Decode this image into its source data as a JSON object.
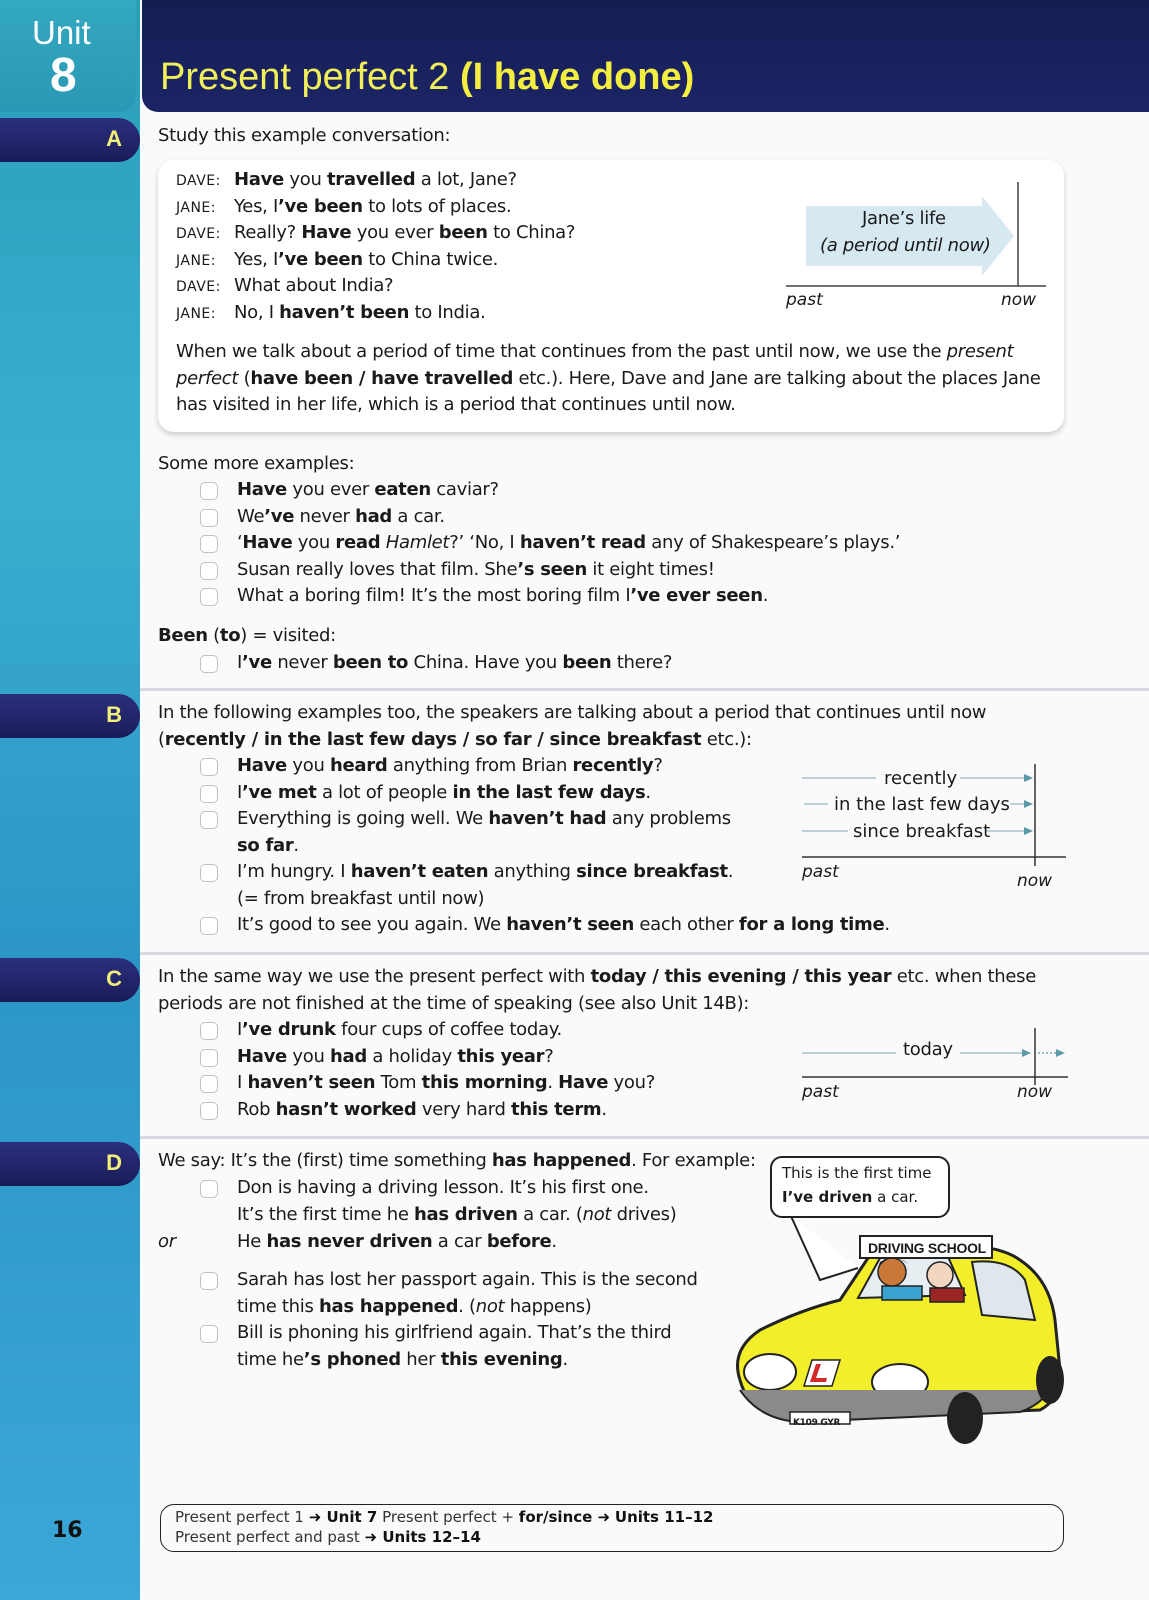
{
  "header": {
    "unit_label": "Unit",
    "unit_number": "8",
    "title_plain": "Present perfect 2 ",
    "title_bold": "(I have done)"
  },
  "page_number": "16",
  "sections": {
    "A": {
      "letter": "A",
      "intro": "Study this example conversation:",
      "dialogue": [
        {
          "speaker": "DAVE:",
          "parts": [
            {
              "b": true,
              "t": "Have"
            },
            {
              "t": " you "
            },
            {
              "b": true,
              "t": "travelled"
            },
            {
              "t": " a lot, Jane?"
            }
          ]
        },
        {
          "speaker": "JANE:",
          "parts": [
            {
              "t": "Yes, I"
            },
            {
              "b": true,
              "t": "’ve been"
            },
            {
              "t": " to lots of places."
            }
          ]
        },
        {
          "speaker": "DAVE:",
          "parts": [
            {
              "t": "Really?  "
            },
            {
              "b": true,
              "t": "Have"
            },
            {
              "t": " you ever "
            },
            {
              "b": true,
              "t": "been"
            },
            {
              "t": " to China?"
            }
          ]
        },
        {
          "speaker": "JANE:",
          "parts": [
            {
              "t": "Yes, I"
            },
            {
              "b": true,
              "t": "’ve been"
            },
            {
              "t": " to China twice."
            }
          ]
        },
        {
          "speaker": "DAVE:",
          "parts": [
            {
              "t": "What about India?"
            }
          ]
        },
        {
          "speaker": "JANE:",
          "parts": [
            {
              "t": "No, I "
            },
            {
              "b": true,
              "t": "haven’t been"
            },
            {
              "t": " to India."
            }
          ]
        }
      ],
      "diagram": {
        "label_line1": "Jane’s life",
        "label_line2": "(a period until now)",
        "past": "past",
        "now": "now"
      },
      "explanation": [
        [
          {
            "t": "When we talk about a period of time that continues from the past until now, we use the "
          },
          {
            "i": true,
            "t": "present"
          }
        ],
        [
          {
            "i": true,
            "t": "perfect"
          },
          {
            "t": " ("
          },
          {
            "b": true,
            "t": "have been / have travelled"
          },
          {
            "t": " etc.).  Here, Dave and Jane are talking about the places Jane"
          }
        ],
        [
          {
            "t": "has visited in her life, which is a period that continues until now."
          }
        ]
      ],
      "more_heading": "Some more examples:",
      "examples": [
        [
          {
            "b": true,
            "t": "Have"
          },
          {
            "t": " you ever "
          },
          {
            "b": true,
            "t": "eaten"
          },
          {
            "t": " caviar?"
          }
        ],
        [
          {
            "t": "We"
          },
          {
            "b": true,
            "t": "’ve"
          },
          {
            "t": " never "
          },
          {
            "b": true,
            "t": "had"
          },
          {
            "t": " a car."
          }
        ],
        [
          {
            "t": "‘"
          },
          {
            "b": true,
            "t": "Have"
          },
          {
            "t": " you "
          },
          {
            "b": true,
            "t": "read"
          },
          {
            "t": " "
          },
          {
            "i": true,
            "t": "Hamlet"
          },
          {
            "t": "?’   ‘No, I "
          },
          {
            "b": true,
            "t": "haven’t read"
          },
          {
            "t": " any of Shakespeare’s plays.’"
          }
        ],
        [
          {
            "t": "Susan really loves that film.  She"
          },
          {
            "b": true,
            "t": "’s seen"
          },
          {
            "t": " it eight times!"
          }
        ],
        [
          {
            "t": "What a boring film!  It’s the most boring film I"
          },
          {
            "b": true,
            "t": "’ve ever seen"
          },
          {
            "t": "."
          }
        ]
      ],
      "been_heading": [
        {
          "b": true,
          "t": "Been"
        },
        {
          "t": " ("
        },
        {
          "b": true,
          "t": "to"
        },
        {
          "t": ") = visited:"
        }
      ],
      "been_example": [
        {
          "t": "I"
        },
        {
          "b": true,
          "t": "’ve"
        },
        {
          "t": " never "
        },
        {
          "b": true,
          "t": "been to"
        },
        {
          "t": " China.  Have you "
        },
        {
          "b": true,
          "t": "been"
        },
        {
          "t": " there?"
        }
      ]
    },
    "B": {
      "letter": "B",
      "intro": [
        [
          {
            "t": "In the following examples too, the speakers are talking about a period that continues until now"
          }
        ],
        [
          {
            "t": "("
          },
          {
            "b": true,
            "t": "recently / in the last few days / so far / since breakfast"
          },
          {
            "t": " etc.):"
          }
        ]
      ],
      "examples": [
        [
          [
            {
              "b": true,
              "t": "Have"
            },
            {
              "t": " you "
            },
            {
              "b": true,
              "t": "heard"
            },
            {
              "t": " anything from Brian "
            },
            {
              "b": true,
              "t": "recently"
            },
            {
              "t": "?"
            }
          ]
        ],
        [
          [
            {
              "t": "I"
            },
            {
              "b": true,
              "t": "’ve met"
            },
            {
              "t": " a lot of people "
            },
            {
              "b": true,
              "t": "in the last few days"
            },
            {
              "t": "."
            }
          ]
        ],
        [
          [
            {
              "t": "Everything is going well.  We "
            },
            {
              "b": true,
              "t": "haven’t had"
            },
            {
              "t": " any problems"
            }
          ],
          [
            {
              "b": true,
              "t": "so far"
            },
            {
              "t": "."
            }
          ]
        ],
        [
          [
            {
              "t": "I’m hungry.  I "
            },
            {
              "b": true,
              "t": "haven’t eaten"
            },
            {
              "t": " anything "
            },
            {
              "b": true,
              "t": "since breakfast"
            },
            {
              "t": "."
            }
          ],
          [
            {
              "t": "(= from breakfast until now)"
            }
          ]
        ],
        [
          [
            {
              "t": "It’s good to see you again.  We "
            },
            {
              "b": true,
              "t": "haven’t seen"
            },
            {
              "t": " each other "
            },
            {
              "b": true,
              "t": "for a long time"
            },
            {
              "t": "."
            }
          ]
        ]
      ],
      "diagram": {
        "lines": [
          "recently",
          "in the last few days",
          "since breakfast"
        ],
        "past": "past",
        "now": "now"
      }
    },
    "C": {
      "letter": "C",
      "intro": [
        [
          {
            "t": "In the same way we use the present perfect with "
          },
          {
            "b": true,
            "t": "today / this evening / this year"
          },
          {
            "t": " etc. when these"
          }
        ],
        [
          {
            "t": "periods are not finished at the time of speaking (see also Unit 14B):"
          }
        ]
      ],
      "examples": [
        [
          {
            "t": "I"
          },
          {
            "b": true,
            "t": "’ve drunk"
          },
          {
            "t": " four cups of coffee today."
          }
        ],
        [
          {
            "b": true,
            "t": "Have"
          },
          {
            "t": " you "
          },
          {
            "b": true,
            "t": "had"
          },
          {
            "t": " a holiday "
          },
          {
            "b": true,
            "t": "this year"
          },
          {
            "t": "?"
          }
        ],
        [
          {
            "t": "I "
          },
          {
            "b": true,
            "t": "haven’t seen"
          },
          {
            "t": " Tom "
          },
          {
            "b": true,
            "t": "this morning"
          },
          {
            "t": ".  "
          },
          {
            "b": true,
            "t": "Have"
          },
          {
            "t": " you?"
          }
        ],
        [
          {
            "t": "Rob "
          },
          {
            "b": true,
            "t": "hasn’t worked"
          },
          {
            "t": " very hard "
          },
          {
            "b": true,
            "t": "this term"
          },
          {
            "t": "."
          }
        ]
      ],
      "diagram": {
        "label": "today",
        "past": "past",
        "now": "now"
      }
    },
    "D": {
      "letter": "D",
      "intro": [
        {
          "t": "We say: It’s the (first) time something "
        },
        {
          "b": true,
          "t": "has happened"
        },
        {
          "t": ".  For example:"
        }
      ],
      "ex1_line1": [
        {
          "t": "Don is having a driving lesson.  It’s his first one."
        }
      ],
      "ex1_line2": [
        {
          "t": "It’s the first time he "
        },
        {
          "b": true,
          "t": "has driven"
        },
        {
          "t": " a car.   ("
        },
        {
          "i": true,
          "t": "not"
        },
        {
          "t": " drives)"
        }
      ],
      "or_label": "or",
      "ex1_line3": [
        {
          "t": "He "
        },
        {
          "b": true,
          "t": "has never driven"
        },
        {
          "t": " a car "
        },
        {
          "b": true,
          "t": "before"
        },
        {
          "t": "."
        }
      ],
      "ex2": [
        [
          {
            "t": "Sarah has lost her passport again.  This is the second"
          }
        ],
        [
          {
            "t": "time this "
          },
          {
            "b": true,
            "t": "has happened"
          },
          {
            "t": ".   ("
          },
          {
            "i": true,
            "t": "not"
          },
          {
            "t": " happens)"
          }
        ]
      ],
      "ex3": [
        [
          {
            "t": "Bill is phoning his girlfriend again.  That’s the third"
          }
        ],
        [
          {
            "t": "time he"
          },
          {
            "b": true,
            "t": "’s phoned"
          },
          {
            "t": " her "
          },
          {
            "b": true,
            "t": "this evening"
          },
          {
            "t": "."
          }
        ]
      ],
      "bubble": [
        [
          {
            "t": "This is the first time"
          }
        ],
        [
          {
            "b": true,
            "t": "I’ve driven"
          },
          {
            "t": " a car."
          }
        ]
      ],
      "illustration": {
        "sign": "DRIVING SCHOOL",
        "plate": "K109 GYR"
      }
    }
  },
  "footer": {
    "line1": [
      {
        "t": "Present perfect 1 "
      },
      {
        "b": true,
        "t": "➜ Unit 7"
      },
      {
        "t": "       Present perfect + "
      },
      {
        "b": true,
        "t": "for/since ➜"
      },
      {
        "t": " "
      },
      {
        "b": true,
        "t": "Units 11–12"
      }
    ],
    "line2": [
      {
        "t": "Present perfect and past "
      },
      {
        "b": true,
        "t": "➜ Units 12–14"
      }
    ]
  },
  "colors": {
    "title_yellow": "#f0ef5a",
    "navy": "#1c2466",
    "teal": "#2a9fb8",
    "arrow_teal": "#5a9aa6",
    "car_yellow": "#f2ee2a"
  }
}
